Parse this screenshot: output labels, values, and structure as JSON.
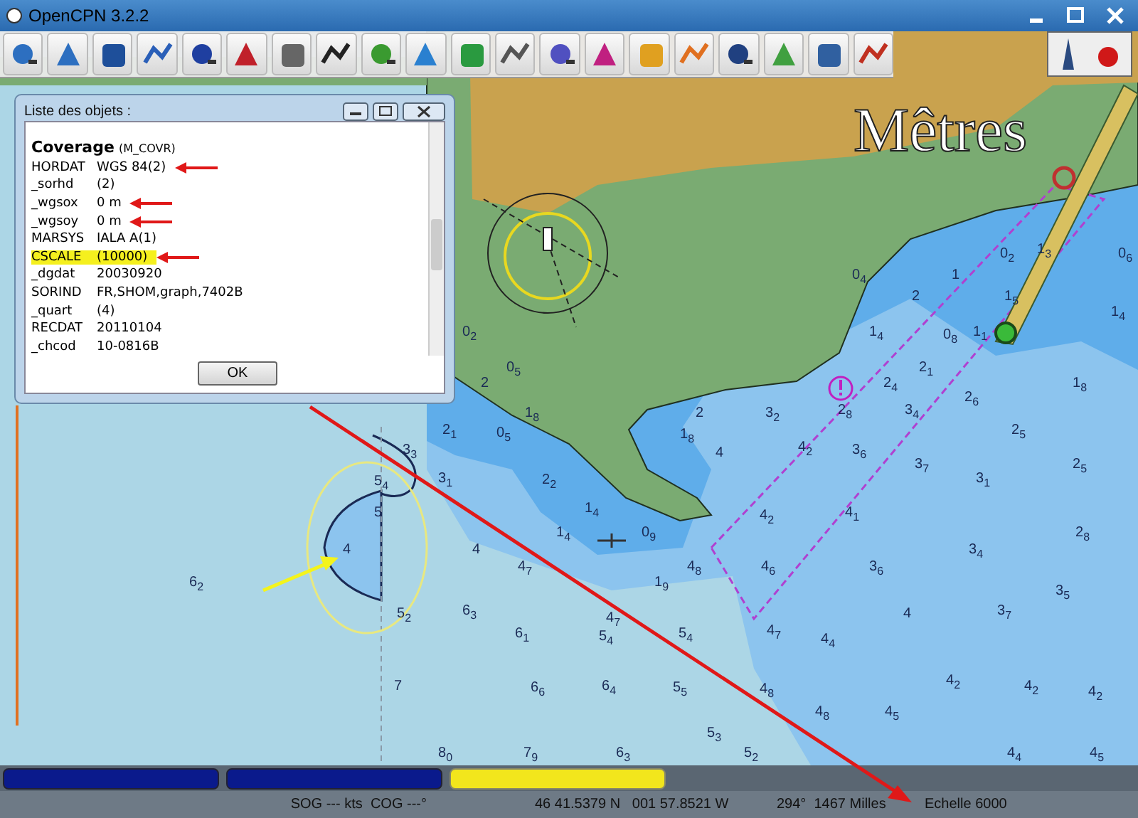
{
  "window": {
    "title": "OpenCPN 3.2.2"
  },
  "chart_overlay_label": "Mêtres",
  "soundings": [
    "0$_{2}$",
    "1$_{3}$",
    "0$_{6}$",
    "0$_{4}$",
    "1",
    "2",
    "1$_{5}$",
    "1$_{4}$",
    "0$_{2}$",
    "1$_{4}$",
    "0$_{8}$",
    "1$_{1}$",
    "0$_{5}$",
    "2$_{1}$",
    "2",
    "2$_{4}$",
    "1$_{8}$",
    "2$_{6}$",
    "1$_{8}$",
    "2",
    "3$_{2}$",
    "2$_{8}$",
    "3$_{4}$",
    "2$_{1}$",
    "0$_{5}$",
    "1$_{8}$",
    "2$_{5}$",
    "3$_{3}$",
    "4",
    "4$_{2}$",
    "3$_{6}$",
    "3$_{7}$",
    "2$_{5}$",
    "5$_{4}$",
    "3$_{1}$",
    "2$_{2}$",
    "3$_{1}$",
    "5",
    "1$_{4}$",
    "4$_{2}$",
    "4$_{1}$",
    "1$_{4}$",
    "0$_{9}$",
    "2$_{8}$",
    "4",
    "4",
    "3$_{4}$",
    "4$_{7}$",
    "4$_{8}$",
    "4$_{6}$",
    "3$_{6}$",
    "6$_{2}$",
    "1$_{9}$",
    "3$_{5}$",
    "5$_{2}$",
    "6$_{3}$",
    "4$_{7}$",
    "4",
    "3$_{7}$",
    "6$_{1}$",
    "5$_{4}$",
    "5$_{4}$",
    "4$_{7}$",
    "4$_{4}$",
    "7",
    "6$_{6}$",
    "6$_{4}$",
    "5$_{5}$",
    "4$_{8}$",
    "4$_{2}$",
    "4$_{2}$",
    "4$_{2}$",
    "4$_{8}$",
    "4$_{5}$",
    "5$_{3}$",
    "8$_{0}$",
    "7$_{9}$",
    "6$_{3}$",
    "5$_{2}$",
    "4$_{4}$",
    "4$_{5}$"
  ],
  "dialog": {
    "title": "Liste des objets :",
    "object_name": "Coverage",
    "object_code": "(M_COVR)",
    "rows": [
      {
        "attribute": "HORDAT",
        "value": "WGS 84(2)",
        "highlighted": false,
        "annotated": true
      },
      {
        "attribute": "_sorhd",
        "value": "(2)",
        "highlighted": false,
        "annotated": false
      },
      {
        "attribute": "_wgsox",
        "value": "0 m",
        "highlighted": false,
        "annotated": true
      },
      {
        "attribute": "_wgsoy",
        "value": "0 m",
        "highlighted": false,
        "annotated": true
      },
      {
        "attribute": "MARSYS",
        "value": "IALA A(1)",
        "highlighted": false,
        "annotated": false
      },
      {
        "attribute": "CSCALE",
        "value": "(10000)",
        "highlighted": true,
        "annotated": true
      },
      {
        "attribute": "_dgdat",
        "value": "20030920",
        "highlighted": false,
        "annotated": false
      },
      {
        "attribute": "SORIND",
        "value": "FR,SHOM,graph,7402B",
        "highlighted": false,
        "annotated": false
      },
      {
        "attribute": "_quart",
        "value": "(4)",
        "highlighted": false,
        "annotated": false
      },
      {
        "attribute": "RECDAT",
        "value": "20110104",
        "highlighted": false,
        "annotated": false
      },
      {
        "attribute": "_chcod",
        "value": "10-0816B",
        "highlighted": false,
        "annotated": false
      }
    ],
    "ok_button": "OK"
  },
  "chart_bar": [
    {
      "color": "#0a1a8c",
      "selected": false
    },
    {
      "color": "#0a1a8c",
      "selected": false
    },
    {
      "color": "#f2e61c",
      "selected": true
    }
  ],
  "status_bar": {
    "speed": "SOG --- kts  COG ---°",
    "position": "46 41.5379 N   001 57.8521 W",
    "bearing": "294°  1467 Milles",
    "scale": "Echelle 6000"
  }
}
